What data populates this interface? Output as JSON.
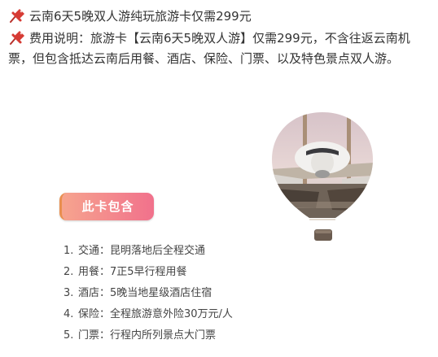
{
  "intro": {
    "line1": "云南6天5晚双人游纯玩旅游卡仅需299元",
    "line2": "费用说明：旅游卡【云南6天5晚双人游】仅需299元，不含往返云南机票，但包含抵达云南后用餐、酒店、保险、门票、以及特色景点双人游。"
  },
  "icons": {
    "pin": "pushpin-icon",
    "pin_color": "#d63b34"
  },
  "badge": {
    "label": "此卡包含"
  },
  "includes": [
    {
      "num": "1.",
      "text": "交通：昆明落地后全程交通"
    },
    {
      "num": "2.",
      "text": "用餐：7正5早行程用餐"
    },
    {
      "num": "3.",
      "text": "酒店：5晚当地星级酒店住宿"
    },
    {
      "num": "4.",
      "text": "保险：全程旅游意外险30万元/人"
    },
    {
      "num": "5.",
      "text": "门票：行程内所列景点大门票"
    }
  ]
}
